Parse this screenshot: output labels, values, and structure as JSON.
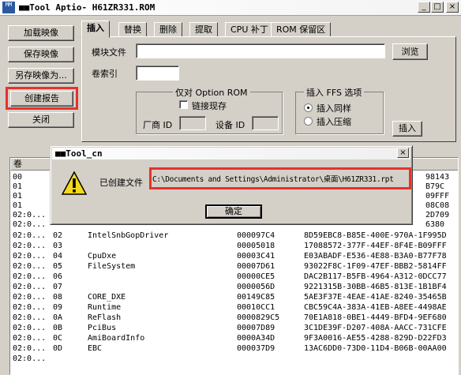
{
  "window": {
    "title": "■■Tool Aptio- H61ZR331.ROM",
    "icon_name": "app-icon",
    "icon_text": "MM"
  },
  "title_buttons": {
    "minimize": "_",
    "maximize": "□",
    "close": "×"
  },
  "left_buttons": {
    "load": "加载映像",
    "save": "保存映像",
    "save_as": "另存映像为...",
    "create_report": "创建报告",
    "close": "关闭"
  },
  "tabs": [
    "插入",
    "替换",
    "删除",
    "提取",
    "CPU 补丁",
    "ROM 保留区"
  ],
  "insert_panel": {
    "module_file_label": "模块文件",
    "module_file_value": "",
    "browse_button": "浏览",
    "volume_index_label": "卷索引",
    "volume_index_value": "",
    "option_rom_group": "仅对 Option ROM",
    "link_existing_label": "链接现存",
    "link_existing_checked": false,
    "vendor_id_label": "厂商 ID",
    "device_id_label": "设备 ID",
    "ffs_group": "插入 FFS 选项",
    "insert_as_is": "插入同样",
    "insert_as_is_selected": true,
    "insert_compressed": "插入压缩",
    "insert_button": "插入"
  },
  "table": {
    "first_header": "卷",
    "first_column_rows": [
      "00",
      "01",
      "01",
      "01",
      "02:0...",
      "02:0..."
    ],
    "rows": [
      {
        "col1": "02",
        "name": "IntelSnbGopDriver",
        "size": "000097C4",
        "guid": "8D59EBC8-B85E-400E-970A-1F995D"
      },
      {
        "col1": "02:0...",
        "col2": "03",
        "name": "",
        "size": "00005018",
        "guid": "17088572-377F-44EF-8F4E-B09FFF"
      },
      {
        "col1": "02:0...",
        "col2": "04",
        "name": "CpuDxe",
        "size": "00003C41",
        "guid": "E03ABADF-E536-4E88-B3A0-B77F78"
      },
      {
        "col1": "02:0...",
        "col2": "05",
        "name": "FileSystem",
        "size": "00007D61",
        "guid": "93022F8C-1F09-47EF-BBB2-5814FF"
      },
      {
        "col1": "02:0...",
        "col2": "06",
        "name": "",
        "size": "00000CE5",
        "guid": "DAC2B117-B5FB-4964-A312-0DCC77"
      },
      {
        "col1": "02:0...",
        "col2": "07",
        "name": "",
        "size": "0000056D",
        "guid": "9221315B-30BB-46B5-813E-1B1BF4"
      },
      {
        "col1": "02:0...",
        "col2": "08",
        "name": "CORE_DXE",
        "size": "00149C85",
        "guid": "5AE3F37E-4EAE-41AE-8240-35465B"
      },
      {
        "col1": "02:0...",
        "col2": "09",
        "name": "Runtime",
        "size": "00010CC1",
        "guid": "CBC59C4A-383A-41EB-A8EE-4498AE"
      },
      {
        "col1": "02:0...",
        "col2": "0A",
        "name": "ReFlash",
        "size": "0000829C5",
        "guid": "70E1A818-0BE1-4449-BFD4-9EF680"
      },
      {
        "col1": "02:0...",
        "col2": "0B",
        "name": "PciBus",
        "size": "00007D89",
        "guid": "3C1DE39F-D207-408A-AACC-731CFE"
      },
      {
        "col1": "02:0...",
        "col2": "0C",
        "name": "AmiBoardInfo",
        "size": "0000A34D",
        "guid": "9F3A0016-AE55-4288-829D-D22FD3"
      },
      {
        "col1": "02:0...",
        "col2": "0D",
        "name": "EBC",
        "size": "000037D9",
        "guid": "13AC6DD0-73D0-11D4-B06B-00AA00"
      }
    ],
    "right_guid_fragments": [
      "98143",
      "B79C",
      "09FFF",
      "08C08",
      "2D709",
      "6380"
    ]
  },
  "dialog": {
    "title": "■■Tool_cn",
    "message_label": "已创建文件",
    "path": "C:\\Documents and Settings\\Administrator\\桌面\\H61ZR331.rpt",
    "ok_button": "确定",
    "icon_name": "warning-icon"
  },
  "colors": {
    "highlight": "#e5322b",
    "chrome": "#d4d0c8",
    "warning_fill": "#f4d91a"
  }
}
